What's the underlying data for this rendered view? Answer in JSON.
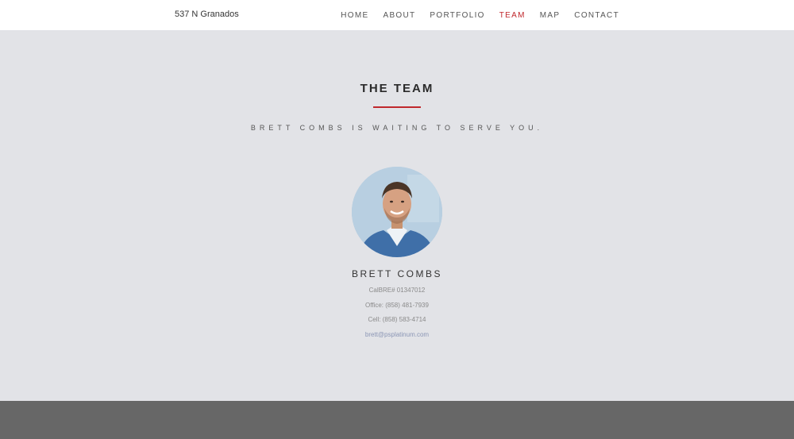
{
  "header": {
    "brand": "537 N Granados",
    "nav": [
      {
        "label": "HOME"
      },
      {
        "label": "ABOUT"
      },
      {
        "label": "PORTFOLIO"
      },
      {
        "label": "TEAM"
      },
      {
        "label": "MAP"
      },
      {
        "label": "CONTACT"
      }
    ],
    "active_label": "TEAM"
  },
  "team": {
    "title": "THE TEAM",
    "subtitle": "BRETT COMBS IS WAITING TO SERVE YOU.",
    "member": {
      "name": "BRETT COMBS",
      "license": "CalBRE# 01347012",
      "office": "Office: (858) 481-7939",
      "cell": "Cell: (858) 583-4714",
      "email": "brett@psplatinum.com"
    }
  },
  "colors": {
    "accent": "#c0282d",
    "background": "#e2e3e7",
    "footer": "#676767"
  }
}
